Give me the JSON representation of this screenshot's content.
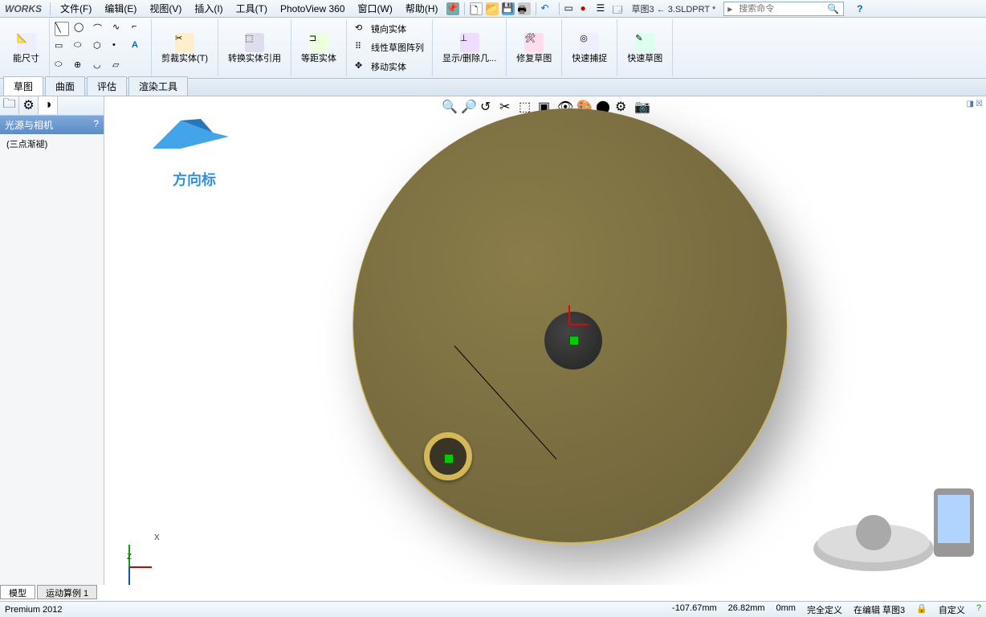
{
  "app": {
    "logo": "WORKS",
    "doc": "草图3 ← 3.SLDPRT *",
    "search_placeholder": "搜索命令",
    "help": "?"
  },
  "menu": {
    "file": "文件(F)",
    "edit": "编辑(E)",
    "view": "视图(V)",
    "insert": "插入(I)",
    "tools": "工具(T)",
    "pv": "PhotoView 360",
    "window": "窗口(W)",
    "help": "帮助(H)"
  },
  "ribbon": {
    "smart_dim": "能尺寸",
    "trim": "剪裁实体(T)",
    "convert": "转换实体引用",
    "offset": "等距实体",
    "mirror": "镜向实体",
    "pattern": "线性草图阵列",
    "move": "移动实体",
    "display": "显示/删除几...",
    "repair": "修复草图",
    "quick_snap": "快速捕捉",
    "quick_sketch": "快速草图"
  },
  "tabs": {
    "sketch": "草图",
    "surface": "曲面",
    "evaluate": "评估",
    "render": "渲染工具"
  },
  "panel": {
    "title": "光源与相机",
    "q": "?",
    "item": "(三点渐褪)"
  },
  "watermark": {
    "logo_text": "方向标"
  },
  "csys": {
    "x": "X",
    "z": "Z"
  },
  "bottom_tabs": {
    "model": "模型",
    "motion": "运动算例 1"
  },
  "status": {
    "version": "Premium 2012",
    "x": "-107.67mm",
    "y": "26.82mm",
    "z": "0mm",
    "defined": "完全定义",
    "editing": "在编辑 草图3",
    "custom": "自定义"
  }
}
